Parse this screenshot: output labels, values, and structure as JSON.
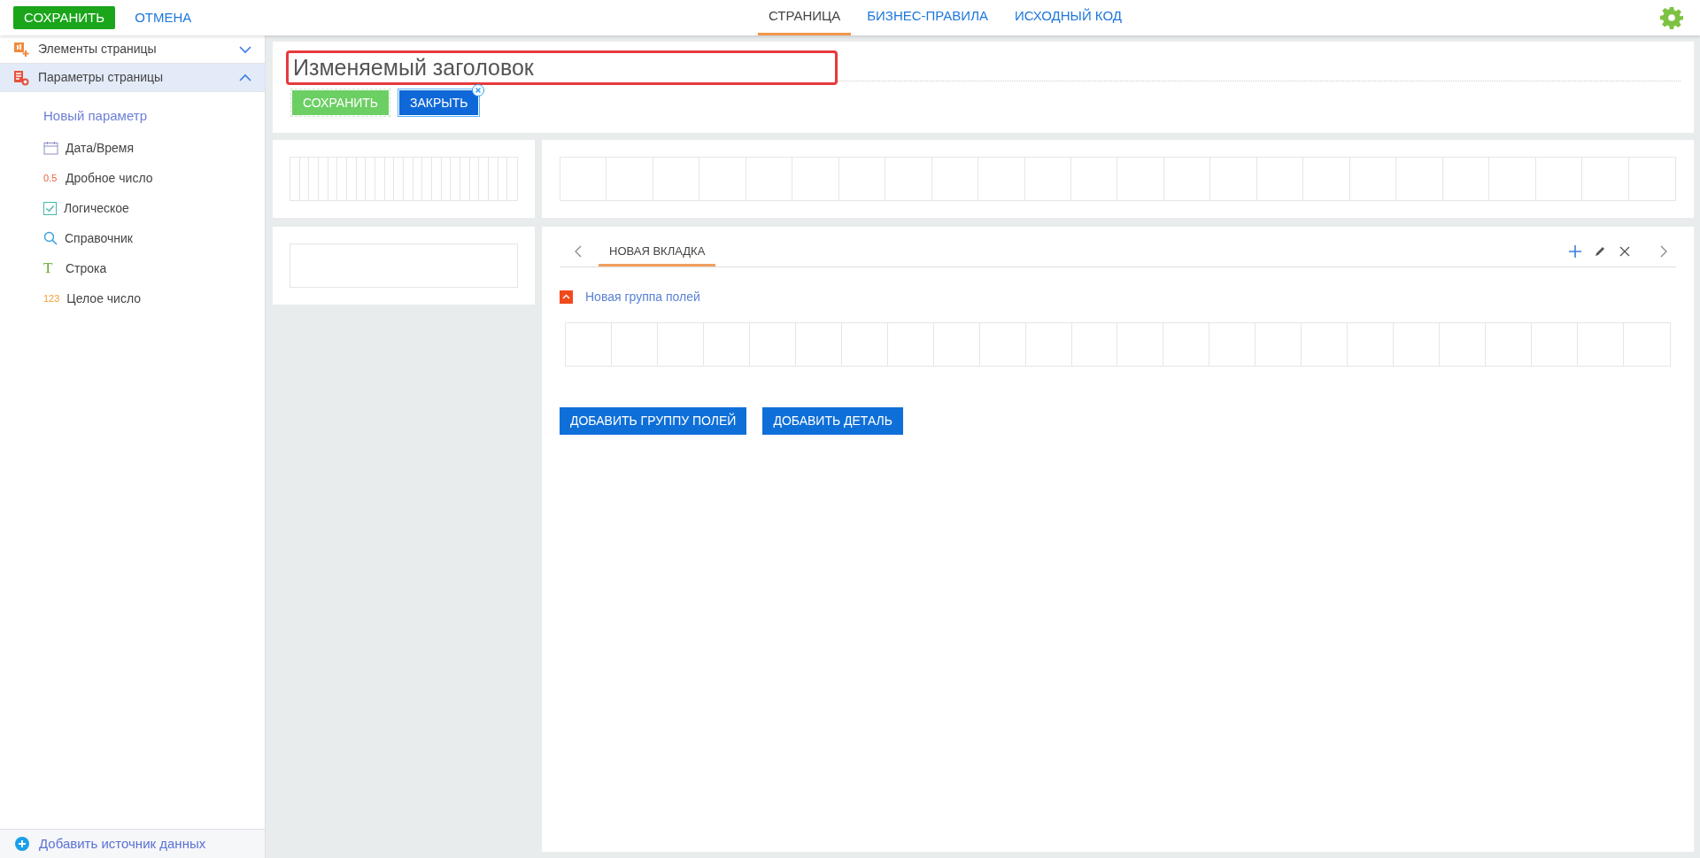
{
  "toolbar": {
    "buttons": [
      {
        "kind": "primary",
        "label": "СОХРАНИТЬ"
      },
      {
        "kind": "link",
        "label": "ОТМЕНА"
      }
    ],
    "tabs": [
      {
        "label": "СТРАНИЦА",
        "selected": true
      },
      {
        "label": "БИЗНЕС-ПРАВИЛА",
        "selected": false
      },
      {
        "label": "ИСХОДНЫЙ КОД",
        "selected": false
      }
    ]
  },
  "sidebar": {
    "sections": [
      {
        "label": "Элементы страницы",
        "expanded": false,
        "selected": false
      },
      {
        "label": "Параметры страницы",
        "expanded": true,
        "selected": true,
        "heading": "Новый параметр",
        "items": [
          {
            "kind": "calendar",
            "label": "Дата/Время"
          },
          {
            "kind": "text",
            "icon_text": "0.5",
            "color": "#e8603c",
            "label": "Дробное число"
          },
          {
            "kind": "checkbox",
            "label": "Логическое"
          },
          {
            "kind": "search",
            "label": "Справочник"
          },
          {
            "kind": "text",
            "icon_text": "T",
            "color": "#6aab2e",
            "label": "Строка"
          },
          {
            "kind": "text",
            "icon_text": "123",
            "color": "#f0a030",
            "label": "Целое число"
          }
        ]
      }
    ],
    "footer": "Добавить источник данных"
  },
  "header": {
    "title": "Изменяемый заголовок",
    "buttons": [
      {
        "kind": "save",
        "label": "СОХРАНИТЬ"
      },
      {
        "kind": "close",
        "label": "ЗАКРЫТЬ"
      }
    ]
  },
  "tab_panel": {
    "tabs": [
      {
        "label": "НОВАЯ ВКЛАДКА",
        "selected": true
      }
    ],
    "group": {
      "title": "Новая группа полей",
      "expanded": true
    },
    "buttons": [
      "ДОБАВИТЬ ГРУППУ ПОЛЕЙ",
      "ДОБАВИТЬ ДЕТАЛЬ"
    ]
  }
}
